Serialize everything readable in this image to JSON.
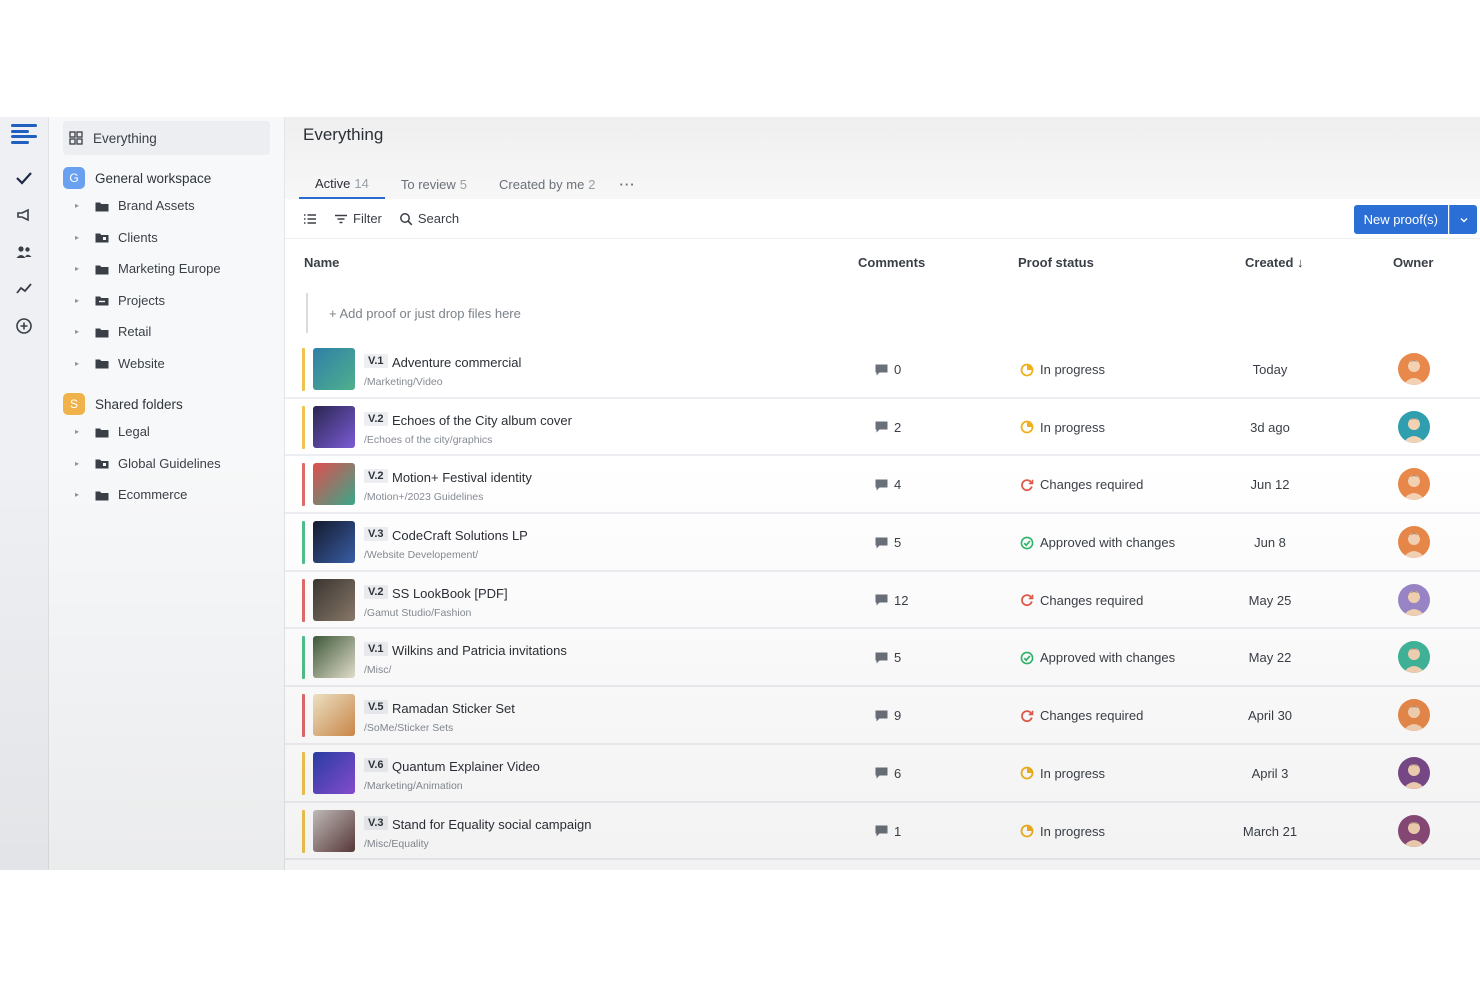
{
  "sidebar": {
    "everything_label": "Everything",
    "workspaces": [
      {
        "badge": "G",
        "badge_color": "#6aa0f0",
        "label": "General workspace",
        "folders": [
          {
            "label": "Brand Assets",
            "icon": "folder-icon"
          },
          {
            "label": "Clients",
            "icon": "clients-folder-icon"
          },
          {
            "label": "Marketing Europe",
            "icon": "folder-icon"
          },
          {
            "label": "Projects",
            "icon": "projects-folder-icon"
          },
          {
            "label": "Retail",
            "icon": "folder-icon"
          },
          {
            "label": "Website",
            "icon": "folder-icon"
          }
        ]
      },
      {
        "badge": "S",
        "badge_color": "#f0b24a",
        "label": "Shared folders",
        "folders": [
          {
            "label": "Legal",
            "icon": "folder-icon"
          },
          {
            "label": "Global Guidelines",
            "icon": "clients-folder-icon"
          },
          {
            "label": "Ecommerce",
            "icon": "folder-icon"
          }
        ]
      }
    ]
  },
  "header": {
    "title": "Everything",
    "tabs": [
      {
        "label": "Active",
        "count": "14"
      },
      {
        "label": "To review",
        "count": "5"
      },
      {
        "label": "Created by me",
        "count": "2"
      }
    ],
    "more_label": "···"
  },
  "toolbar": {
    "filter_label": "Filter",
    "search_label": "Search",
    "new_button_label": "New proof(s)"
  },
  "table": {
    "columns": {
      "name": "Name",
      "comments": "Comments",
      "status": "Proof status",
      "created": "Created ↓",
      "owner": "Owner"
    },
    "add_row_label": "+ Add proof or just drop files here",
    "rows": [
      {
        "version": "V.1",
        "name": "Adventure commercial",
        "path": "/Marketing/Video",
        "comments": "0",
        "status": "In progress",
        "status_kind": "progress",
        "created": "Today",
        "strip": "#f0c24f",
        "thumb": [
          "#2f7fa8",
          "#4fb08c"
        ],
        "avatar": "#e8884a"
      },
      {
        "version": "V.2",
        "name": "Echoes of the City album cover",
        "path": "/Echoes of the city/graphics",
        "comments": "2",
        "status": "In progress",
        "status_kind": "progress",
        "created": "3d ago",
        "strip": "#f0c24f",
        "thumb": [
          "#2a2550",
          "#7b5cd6"
        ],
        "avatar": "#2f9fb0"
      },
      {
        "version": "V.2",
        "name": "Motion+ Festival identity",
        "path": "/Motion+/2023 Guidelines",
        "comments": "4",
        "status": "Changes required",
        "status_kind": "changes",
        "created": "Jun 12",
        "strip": "#e06a6a",
        "thumb": [
          "#e04e4e",
          "#3aa88a"
        ],
        "avatar": "#e8884a"
      },
      {
        "version": "V.3",
        "name": "CodeCraft Solutions LP",
        "path": "/Website Developement/",
        "comments": "5",
        "status": "Approved with changes",
        "status_kind": "approved",
        "created": "Jun 8",
        "strip": "#4fbf8a",
        "thumb": [
          "#141a2e",
          "#3a5fa8"
        ],
        "avatar": "#e8884a"
      },
      {
        "version": "V.2",
        "name": "SS LookBook [PDF]",
        "path": "/Gamut Studio/Fashion",
        "comments": "12",
        "status": "Changes required",
        "status_kind": "changes",
        "created": "May 25",
        "strip": "#e06a6a",
        "thumb": [
          "#3a3532",
          "#8a7a6a"
        ],
        "avatar": "#9a86c8"
      },
      {
        "version": "V.1",
        "name": "Wilkins and Patricia invitations",
        "path": "/Misc/",
        "comments": "5",
        "status": "Approved with changes",
        "status_kind": "approved",
        "created": "May 22",
        "strip": "#4fbf8a",
        "thumb": [
          "#3e5a3a",
          "#e8e2d0"
        ],
        "avatar": "#3fb59a"
      },
      {
        "version": "V.5",
        "name": "Ramadan Sticker Set",
        "path": "/SoMe/Sticker Sets",
        "comments": "9",
        "status": "Changes required",
        "status_kind": "changes",
        "created": "April 30",
        "strip": "#e06a6a",
        "thumb": [
          "#f2e6c8",
          "#d08a4a"
        ],
        "avatar": "#e8884a"
      },
      {
        "version": "V.6",
        "name": "Quantum Explainer Video",
        "path": "/Marketing/Animation",
        "comments": "6",
        "status": "In progress",
        "status_kind": "progress",
        "created": "April 3",
        "strip": "#f0c24f",
        "thumb": [
          "#2a3ea8",
          "#8a4fd6"
        ],
        "avatar": "#7a4a8a"
      },
      {
        "version": "V.3",
        "name": "Stand for Equality social campaign",
        "path": "/Misc/Equality",
        "comments": "1",
        "status": "In progress",
        "status_kind": "progress",
        "created": "March 21",
        "strip": "#f0c24f",
        "thumb": [
          "#c8c2c0",
          "#5a3a3a"
        ],
        "avatar": "#8a4a7a"
      }
    ]
  },
  "colors": {
    "accent": "#2b6fd6",
    "progress": "#f0b01e",
    "changes": "#e05a4a",
    "approved": "#2fb56a"
  }
}
